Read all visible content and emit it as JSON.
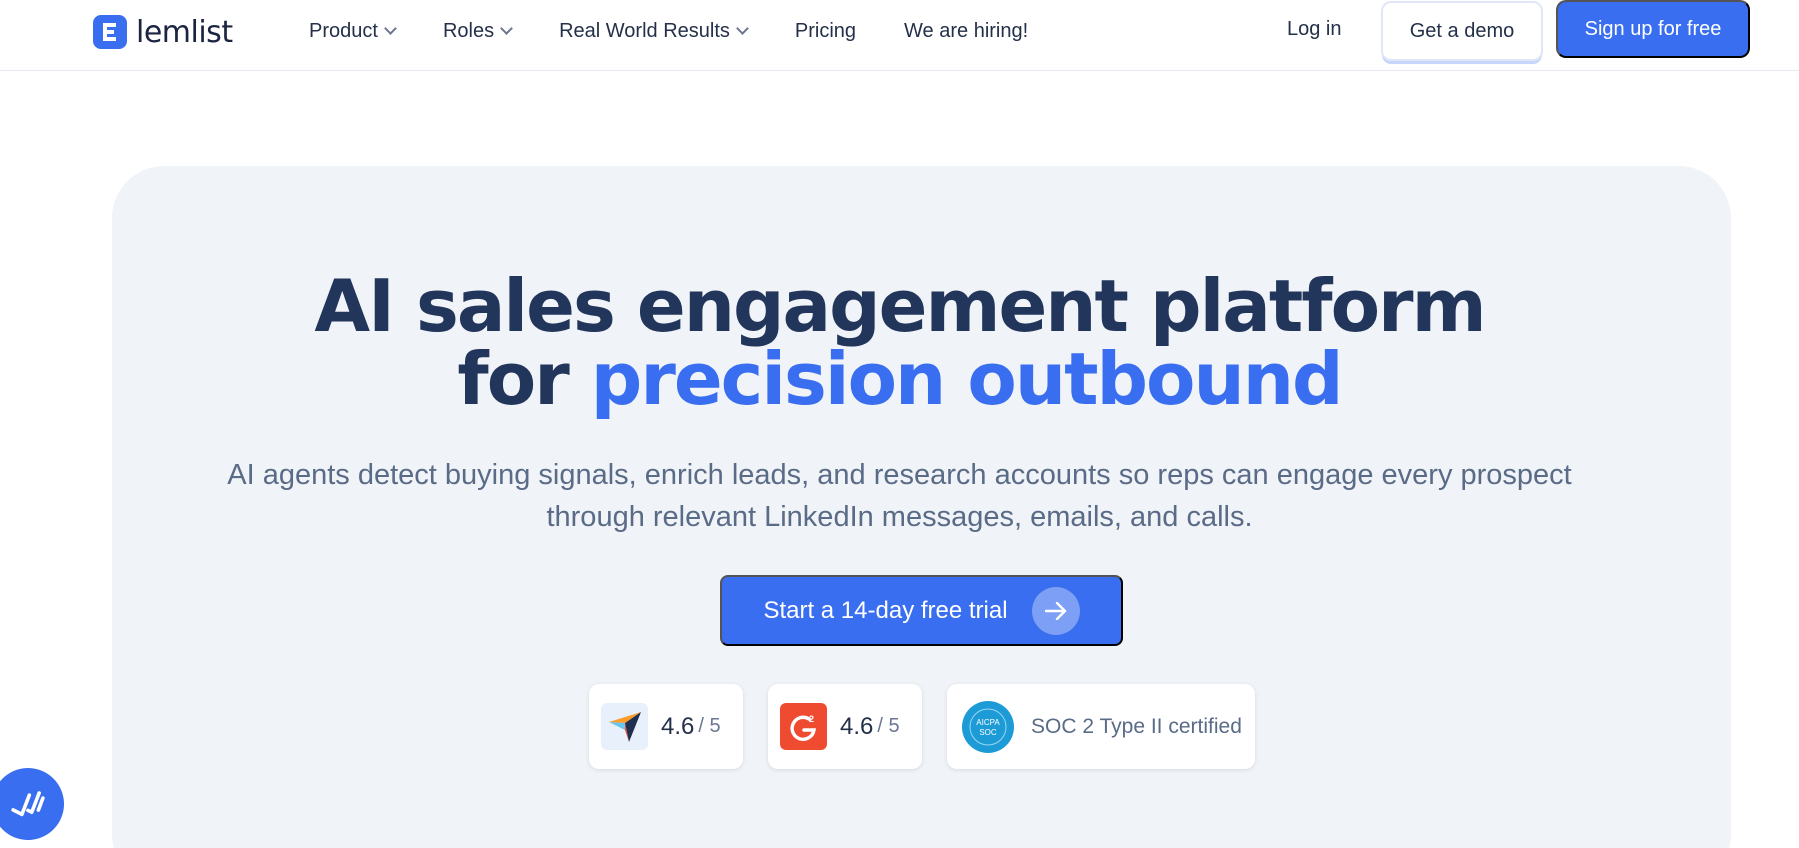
{
  "nav": {
    "logo_text": "lemlist",
    "menu": [
      {
        "label": "Product",
        "dropdown": true
      },
      {
        "label": "Roles",
        "dropdown": true
      },
      {
        "label": "Real World Results",
        "dropdown": true
      },
      {
        "label": "Pricing",
        "dropdown": false
      },
      {
        "label": "We are hiring!",
        "dropdown": false
      }
    ],
    "login_label": "Log in",
    "demo_label": "Get a demo",
    "signup_label": "Sign up for free"
  },
  "hero": {
    "headline_line1": "AI sales engagement platform",
    "headline_line2_prefix": "for",
    "headline_line2_accent": "precision outbound",
    "subtitle_line1": "AI agents detect buying signals, enrich leads, and research accounts so reps can engage every prospect",
    "subtitle_line2": "through relevant LinkedIn messages, emails, and calls.",
    "cta_label": "Start a 14-day free trial"
  },
  "badges": [
    {
      "icon": "capterra-icon",
      "score": "4.6",
      "out_of": "/ 5"
    },
    {
      "icon": "g2-icon",
      "score": "4.6",
      "out_of": "/ 5"
    },
    {
      "icon": "aicpa-soc-icon",
      "seal_text": "AICPA SOC",
      "text": "SOC 2 Type II certified"
    }
  ],
  "colors": {
    "accent": "#3a6ef0",
    "heading": "#22355a",
    "hero_bg": "#f0f3f7",
    "g2_red": "#ef4b31"
  }
}
